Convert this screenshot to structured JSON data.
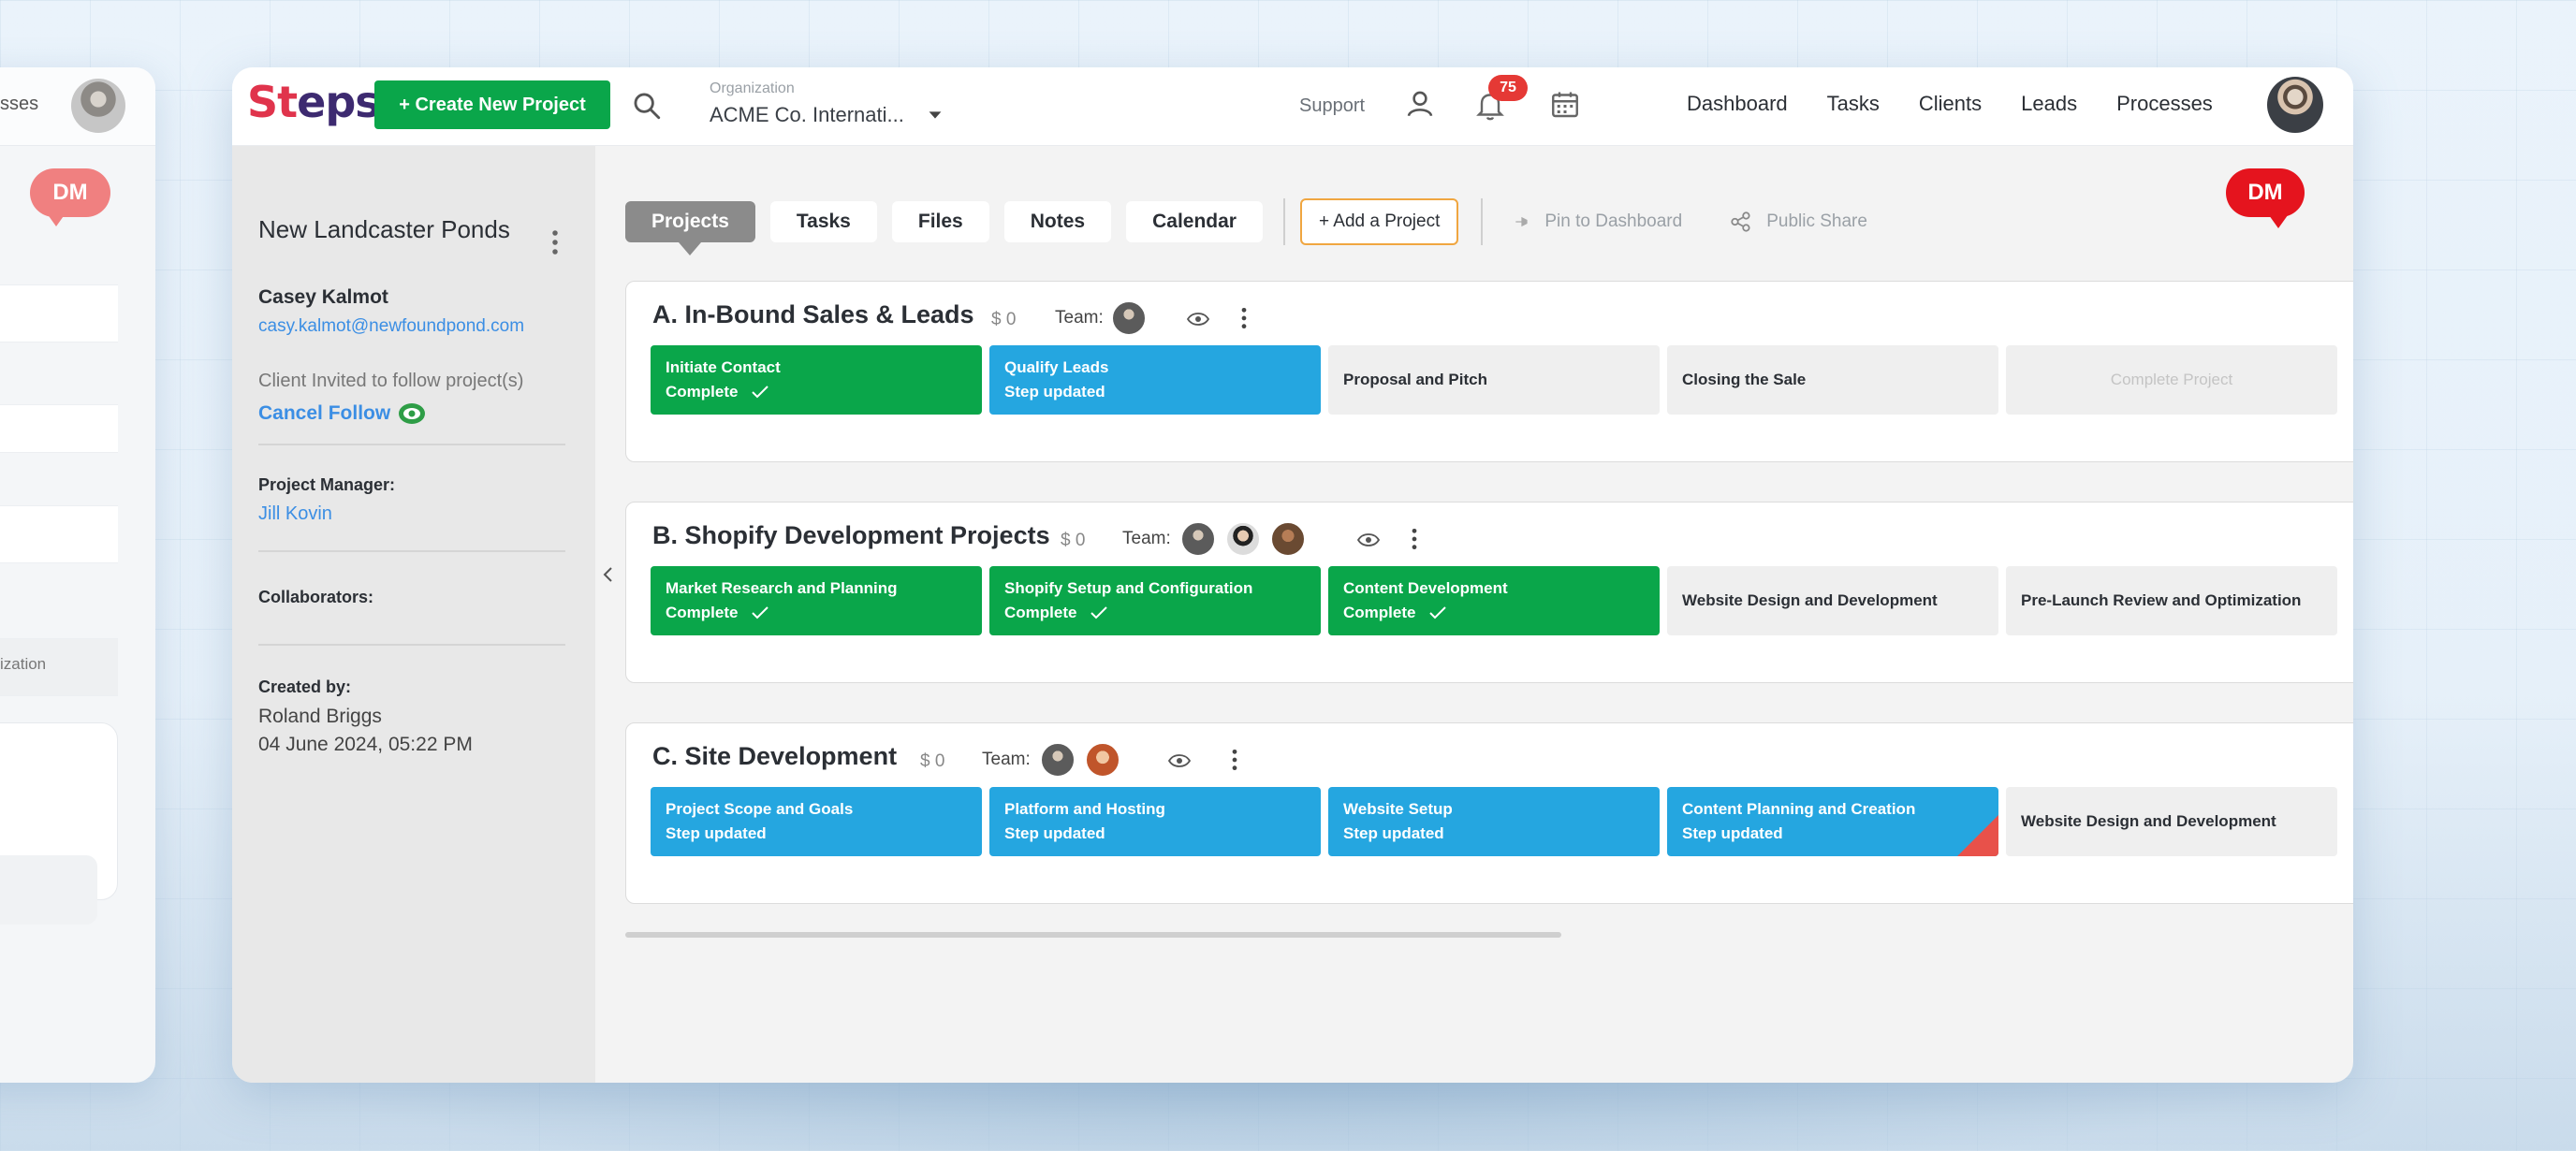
{
  "bg_window": {
    "nav_text": "sses",
    "dm_label": "DM",
    "row_label": "ization"
  },
  "topbar": {
    "logo_part1": "St",
    "logo_part2": "eps",
    "create_button": "+ Create New Project",
    "org_label": "Organization",
    "org_value": "ACME Co. Internati...",
    "support": "Support",
    "notification_count": "75",
    "nav": [
      "Dashboard",
      "Tasks",
      "Clients",
      "Leads",
      "Processes"
    ]
  },
  "sidebar": {
    "project_title": "New Landcaster Ponds",
    "client_name": "Casey Kalmot",
    "client_email": "casy.kalmot@newfoundpond.com",
    "invited_text": "Client Invited to follow project(s)",
    "cancel_follow": "Cancel Follow",
    "pm_label": "Project Manager:",
    "pm_value": "Jill Kovin",
    "collaborators_label": "Collaborators:",
    "created_label": "Created by:",
    "created_by": "Roland Briggs",
    "created_at": "04 June 2024, 05:22 PM"
  },
  "tabs": [
    "Projects",
    "Tasks",
    "Files",
    "Notes",
    "Calendar"
  ],
  "active_tab": "Projects",
  "actions": {
    "add_project": "+ Add a Project",
    "pin": "Pin to Dashboard",
    "share": "Public Share"
  },
  "dm_label": "DM",
  "team_label": "Team:",
  "projects": [
    {
      "title": "A. In-Bound Sales & Leads",
      "amount": "$ 0",
      "steps": [
        {
          "name": "Initiate Contact",
          "status": "Complete"
        },
        {
          "name": "Qualify Leads",
          "status": "Step updated"
        },
        {
          "name": "Proposal and Pitch",
          "status": ""
        },
        {
          "name": "Closing the Sale",
          "status": ""
        },
        {
          "name": "Complete Project",
          "status": ""
        }
      ]
    },
    {
      "title": "B. Shopify Development Projects",
      "amount": "$ 0",
      "steps": [
        {
          "name": "Market Research and Planning",
          "status": "Complete"
        },
        {
          "name": "Shopify Setup and Configuration",
          "status": "Complete"
        },
        {
          "name": "Content Development",
          "status": "Complete"
        },
        {
          "name": "Website Design and Development",
          "status": ""
        },
        {
          "name": "Pre-Launch Review and Optimization",
          "status": ""
        }
      ]
    },
    {
      "title": "C. Site Development",
      "amount": "$ 0",
      "steps": [
        {
          "name": "Project Scope and Goals",
          "status": "Step updated"
        },
        {
          "name": "Platform and Hosting",
          "status": "Step updated"
        },
        {
          "name": "Website Setup",
          "status": "Step updated"
        },
        {
          "name": "Content Planning and Creation",
          "status": "Step updated"
        },
        {
          "name": "Website Design and Development",
          "status": ""
        }
      ]
    }
  ]
}
